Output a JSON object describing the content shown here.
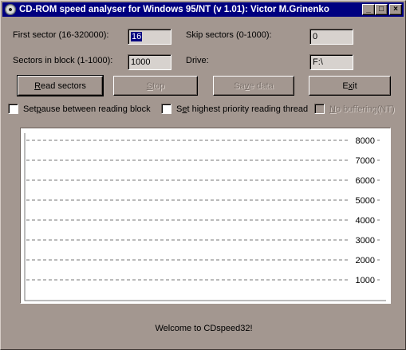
{
  "window": {
    "title": "CD-ROM speed analyser for Windows 95/NT (v 1.01): Victor M.Grinenko",
    "minimize_glyph": "_",
    "maximize_glyph": "□",
    "close_glyph": "×"
  },
  "form": {
    "first_sector_label": "First sector (16-320000):",
    "first_sector_value": "16",
    "skip_sectors_label": "Skip sectors (0-1000):",
    "skip_sectors_value": "0",
    "sectors_in_block_label": "Sectors in block (1-1000):",
    "sectors_in_block_value": "1000",
    "drive_label": "Drive:",
    "drive_value": "F:\\"
  },
  "buttons": {
    "read": {
      "label_u": "R",
      "label_rest": "ead sectors"
    },
    "stop": {
      "label_u": "S",
      "label_rest": "top"
    },
    "save": {
      "label_pre": "Sa",
      "label_u": "v",
      "label_rest": "e data"
    },
    "exit": {
      "label_pre": "E",
      "label_u": "x",
      "label_rest": "it"
    }
  },
  "options": {
    "pause": {
      "pre": "Set ",
      "u": "p",
      "rest": "ause between reading block",
      "checked": false
    },
    "priority": {
      "pre": "S",
      "u": "e",
      "rest": "t highest priority reading thread",
      "checked": false
    },
    "nobuffer": {
      "pre": "",
      "u": "N",
      "rest": "o buffering(NT)",
      "checked": false,
      "disabled": true
    }
  },
  "chart_data": {
    "type": "line",
    "ylim": [
      0,
      8000
    ],
    "yticks": [
      1000,
      2000,
      3000,
      4000,
      5000,
      6000,
      7000,
      8000
    ],
    "ytick_labels": [
      "1000",
      "2000",
      "3000",
      "4000",
      "5000",
      "6000",
      "7000",
      "8000"
    ],
    "grid": "dashed horizontal",
    "series": []
  },
  "status": {
    "text": "Welcome to CDspeed32!"
  }
}
